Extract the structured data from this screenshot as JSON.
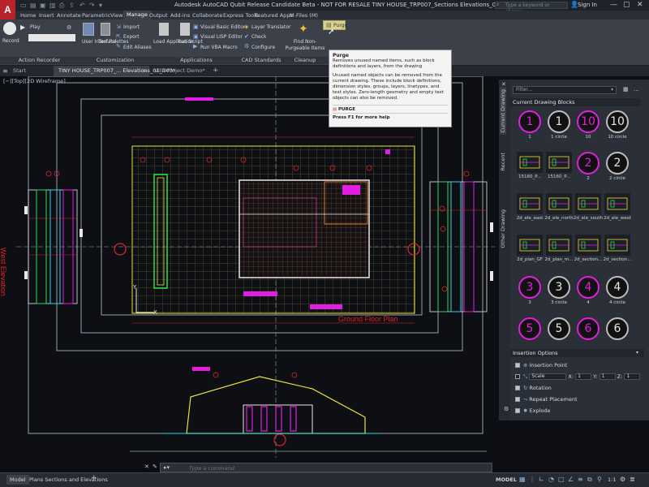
{
  "app": {
    "logo": "A",
    "title": "Autodesk AutoCAD Qubit Release Candidate Beta - NOT FOR RESALE    TINY HOUSE_TRP007_Sections Elevations_01_D03.dwg",
    "search_placeholder": "Type a keyword or phrase",
    "sign_in": "Sign In"
  },
  "ribbon_tabs": [
    "Home",
    "Insert",
    "Annotate",
    "Parametric",
    "View",
    "Manage",
    "Output",
    "Add-ins",
    "Collaborate",
    "Express Tools",
    "Featured Apps",
    "M-Files (M)"
  ],
  "ribbon": {
    "record": "Record",
    "play": "Play",
    "action_recorder": "Action Recorder",
    "user_interface": "User Interface",
    "tool_palettes": "Tool Palettes",
    "import": "Import",
    "export": "Export",
    "edit_aliases": "Edit Aliases",
    "customization": "Customization",
    "load_application": "Load Application",
    "run_script": "Run Script",
    "visual_basic_editor": "Visual Basic Editor",
    "visual_lisp_editor": "Visual LISP Editor",
    "run_vba_macro": "Run VBA Macro",
    "applications": "Applications",
    "layer_translator": "Layer Translator",
    "check": "Check",
    "configure": "Configure",
    "cad_standards": "CAD Standards",
    "find_non_purgeable": "Find Non-Purgeable Items",
    "purge": "Purge",
    "cleanup": "Cleanup"
  },
  "doc_tabs": [
    "Start",
    "TINY HOUSE_TRP007_... Elevations_01_D03*",
    "Villa Project Demo*"
  ],
  "viewport_label": "[−][Top][2D Wireframe]",
  "drawing": {
    "west_elevation": "West Elevation",
    "ground_floor_plan": "Ground Floor Plan",
    "axis_y": "Y",
    "axis_x": "X"
  },
  "tooltip": {
    "title": "Purge",
    "desc": "Removes unused named items, such as block definitions and layers, from the drawing",
    "detail": "Unused named objects can be removed from the current drawing. These include block definitions, dimension styles, groups, layers, linetypes, and text styles. Zero-length geometry and empty text objects can also be removed.",
    "command": "PURGE",
    "help": "Press F1 for more help"
  },
  "palette": {
    "filter_placeholder": "Filter...",
    "vertical_tabs": [
      "Current Drawing",
      "Recent",
      "Other Drawing"
    ],
    "section": "Current Drawing Blocks",
    "blocks": [
      {
        "label": "1",
        "glyph": "1",
        "style": "magenta"
      },
      {
        "label": "1 circle",
        "glyph": "1",
        "style": "dark"
      },
      {
        "label": "10",
        "glyph": "10",
        "style": "magenta"
      },
      {
        "label": "10 circle",
        "glyph": "10",
        "style": "dark"
      },
      {
        "label": "15160_P...",
        "glyph": "",
        "style": "thumb"
      },
      {
        "label": "15160_P...",
        "glyph": "",
        "style": "thumb"
      },
      {
        "label": "2",
        "glyph": "2",
        "style": "magenta"
      },
      {
        "label": "2 circle",
        "glyph": "2",
        "style": "dark"
      },
      {
        "label": "2d_ele_east",
        "glyph": "",
        "style": "thumb"
      },
      {
        "label": "2d_ele_north",
        "glyph": "",
        "style": "thumb"
      },
      {
        "label": "2d_ele_south",
        "glyph": "",
        "style": "thumb"
      },
      {
        "label": "2d_ele_west",
        "glyph": "",
        "style": "thumb"
      },
      {
        "label": "2d_plan_GF",
        "glyph": "",
        "style": "thumb"
      },
      {
        "label": "2d_plan_m...",
        "glyph": "",
        "style": "thumb"
      },
      {
        "label": "2d_section...",
        "glyph": "",
        "style": "thumb"
      },
      {
        "label": "2d_section...",
        "glyph": "",
        "style": "thumb"
      },
      {
        "label": "3",
        "glyph": "3",
        "style": "magenta"
      },
      {
        "label": "3 circle",
        "glyph": "3",
        "style": "dark"
      },
      {
        "label": "4",
        "glyph": "4",
        "style": "magenta"
      },
      {
        "label": "4 circle",
        "glyph": "4",
        "style": "dark"
      },
      {
        "label": "",
        "glyph": "5",
        "style": "magenta"
      },
      {
        "label": "",
        "glyph": "5",
        "style": "dark"
      },
      {
        "label": "",
        "glyph": "6",
        "style": "magenta"
      },
      {
        "label": "",
        "glyph": "6",
        "style": "dark"
      }
    ],
    "insertion_options": "Insertion Options",
    "insertion_point": "Insertion Point",
    "x_label": "X:",
    "y_label": "Y:",
    "z_label": "Z:",
    "x_value": "1",
    "y_value": "1",
    "z_value": "1",
    "scale": "Scale",
    "rotation": "Rotation",
    "repeat_placement": "Repeat Placement",
    "explode": "Explode"
  },
  "command_placeholder": "Type a command",
  "status": {
    "model_tab": "Model",
    "layout_tab": "Plans Sections and Elevations",
    "model_button": "MODEL",
    "scale": "1:1"
  },
  "colors": {
    "magenta": "#e21ee0",
    "yellow": "#e8e23a",
    "cyan": "#2bd6e8",
    "green": "#2be04d",
    "red": "#e02525",
    "white": "#e8e8e8",
    "accent": "#b8232a"
  }
}
